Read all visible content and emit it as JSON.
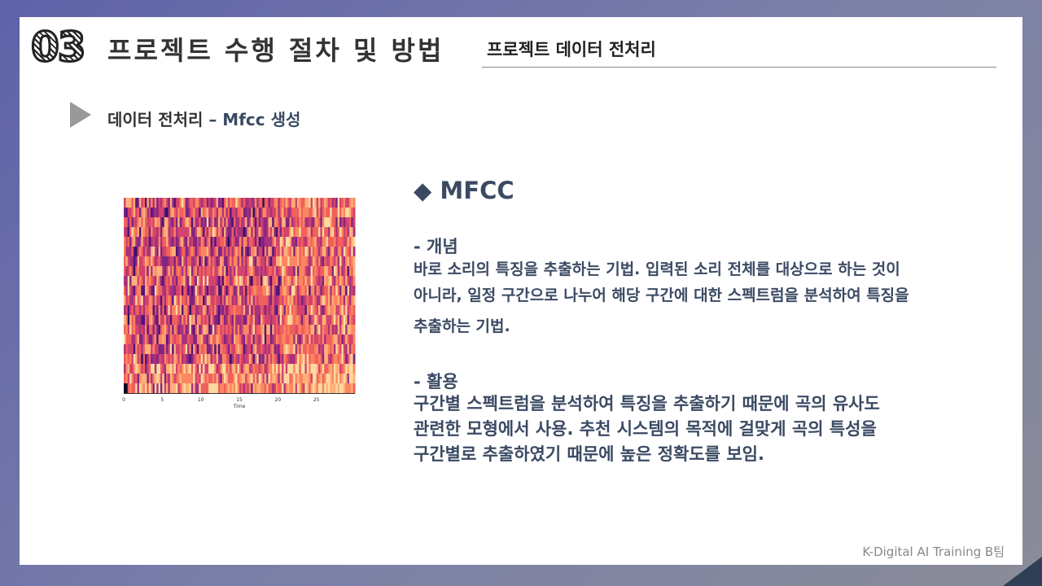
{
  "header": {
    "number": "03",
    "title": "프로젝트 수행 절차 및 방법",
    "subtitle": "프로젝트 데이터 전처리"
  },
  "section": {
    "title": "데이터 전처리",
    "suffix": "– Mfcc 생성"
  },
  "content": {
    "heading": "◆ MFCC",
    "concept_label": "-  개념",
    "concept_lines": [
      "바로 소리의 특징을 추출하는 기법. 입력된 소리 전체를 대상으로 하는 것이",
      "아니라, 일정 구간으로 나누어 해당 구간에 대한 스펙트럼을 분석하여 특징을",
      "추출하는 기법."
    ],
    "usage_label": "-   활용",
    "usage_lines": [
      "구간별 스펙트럼을 분석하여 특징을 추출하기 때문에 곡의 유사도",
      "관련한 모형에서 사용. 추천 시스템의 목적에 걸맞게 곡의 특성을",
      "구간별로 추출하였기 때문에 높은 정확도를 보임."
    ]
  },
  "footer": "K-Digital AI Training B팀",
  "chart_data": {
    "type": "heatmap",
    "title": "",
    "xlabel": "Time",
    "ylabel": "",
    "x_ticks": [
      "0",
      "5",
      "10",
      "15",
      "20",
      "25"
    ],
    "xlim": [
      0,
      30
    ],
    "rows": 20,
    "colormap": "magma"
  }
}
